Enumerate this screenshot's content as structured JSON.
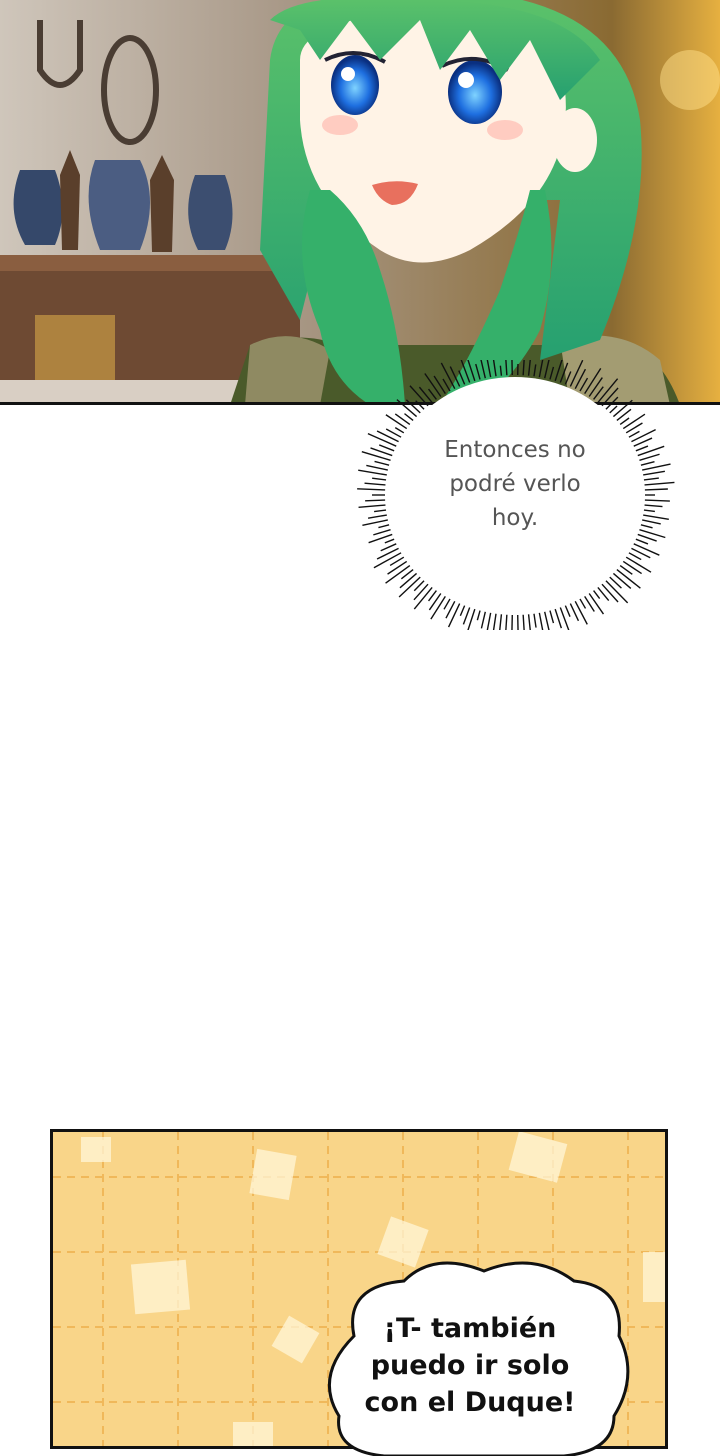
{
  "panels": {
    "top": {
      "scene": "green-haired girl smiling indoors"
    },
    "bottom": {
      "scene": "yellow grid background"
    }
  },
  "dialogue": {
    "burst_bubble": "Entonces no\npodré verlo\nhoy.",
    "cloud_bubble": "¡T- también\npuedo ir solo\ncon el Duque!"
  },
  "colors": {
    "hair": "#3fae5c",
    "eyes": "#1f6fe0",
    "bottom_bg": "#f9d589",
    "grid_line": "#f0b85a"
  }
}
